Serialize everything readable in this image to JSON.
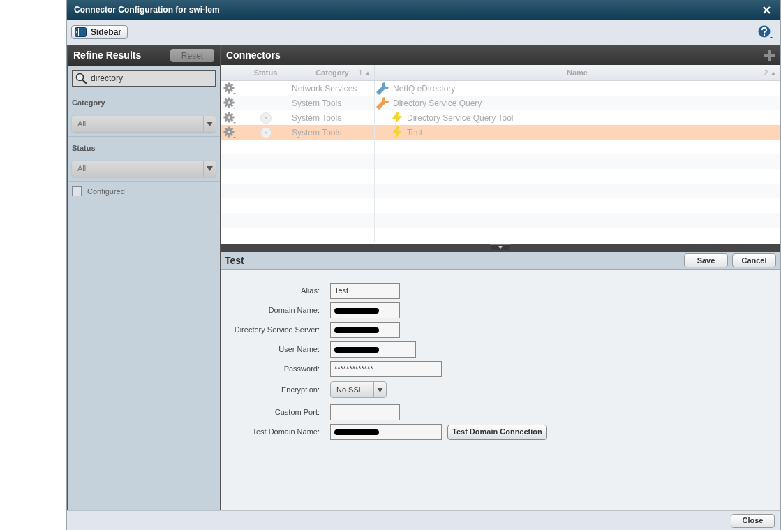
{
  "window": {
    "title": "Connector Configuration for swi-lem"
  },
  "toolbar": {
    "sidebar_button": "Sidebar"
  },
  "sidebar": {
    "title": "Refine Results",
    "reset": "Reset",
    "search": {
      "value": "directory"
    },
    "filters": [
      {
        "label": "Category",
        "value": "All"
      },
      {
        "label": "Status",
        "value": "All"
      }
    ],
    "configured": {
      "label": "Configured",
      "checked": false
    }
  },
  "connectors": {
    "title": "Connectors",
    "columns": [
      {
        "label": "Status"
      },
      {
        "label": "Category",
        "sort": "1 ▲"
      },
      {
        "label": "Name",
        "sort": "2 ▲"
      }
    ],
    "rows": [
      {
        "category": "Network Services",
        "name": "NetIQ eDirectory",
        "kind": "wrench",
        "color": "#6a9ec4",
        "status_shown": false,
        "selected": false
      },
      {
        "category": "System Tools",
        "name": "Directory Service Query",
        "kind": "wrench",
        "color": "#f0a04a",
        "status_shown": false,
        "selected": false,
        "children": [
          {
            "category": "System Tools",
            "name": "Directory Service Query Tool",
            "kind": "bolt",
            "color": "#f5d430",
            "status_shown": true,
            "selected": false
          },
          {
            "category": "System Tools",
            "name": "Test",
            "kind": "bolt",
            "color": "#f5d430",
            "status_shown": true,
            "selected": true
          }
        ]
      }
    ]
  },
  "details": {
    "title": "Test",
    "save": "Save",
    "cancel": "Cancel",
    "fields": [
      {
        "label": "Alias:",
        "kind": "text",
        "value": "Test",
        "redacted": false
      },
      {
        "label": "Domain Name:",
        "kind": "text",
        "redacted": true
      },
      {
        "label": "Directory Service Server:",
        "kind": "text",
        "redacted": true
      },
      {
        "label": "User Name:",
        "kind": "text",
        "redacted": true
      },
      {
        "label": "Password:",
        "kind": "text",
        "value": "*************",
        "redacted": false
      },
      {
        "label": "Encryption:",
        "kind": "select",
        "value": "No SSL"
      },
      {
        "label": "Custom Port:",
        "kind": "text",
        "redacted": false
      },
      {
        "label": "Test Domain Name:",
        "kind": "text",
        "redacted": true,
        "action": "Test Domain Connection"
      }
    ]
  },
  "footer": {
    "close": "Close"
  }
}
